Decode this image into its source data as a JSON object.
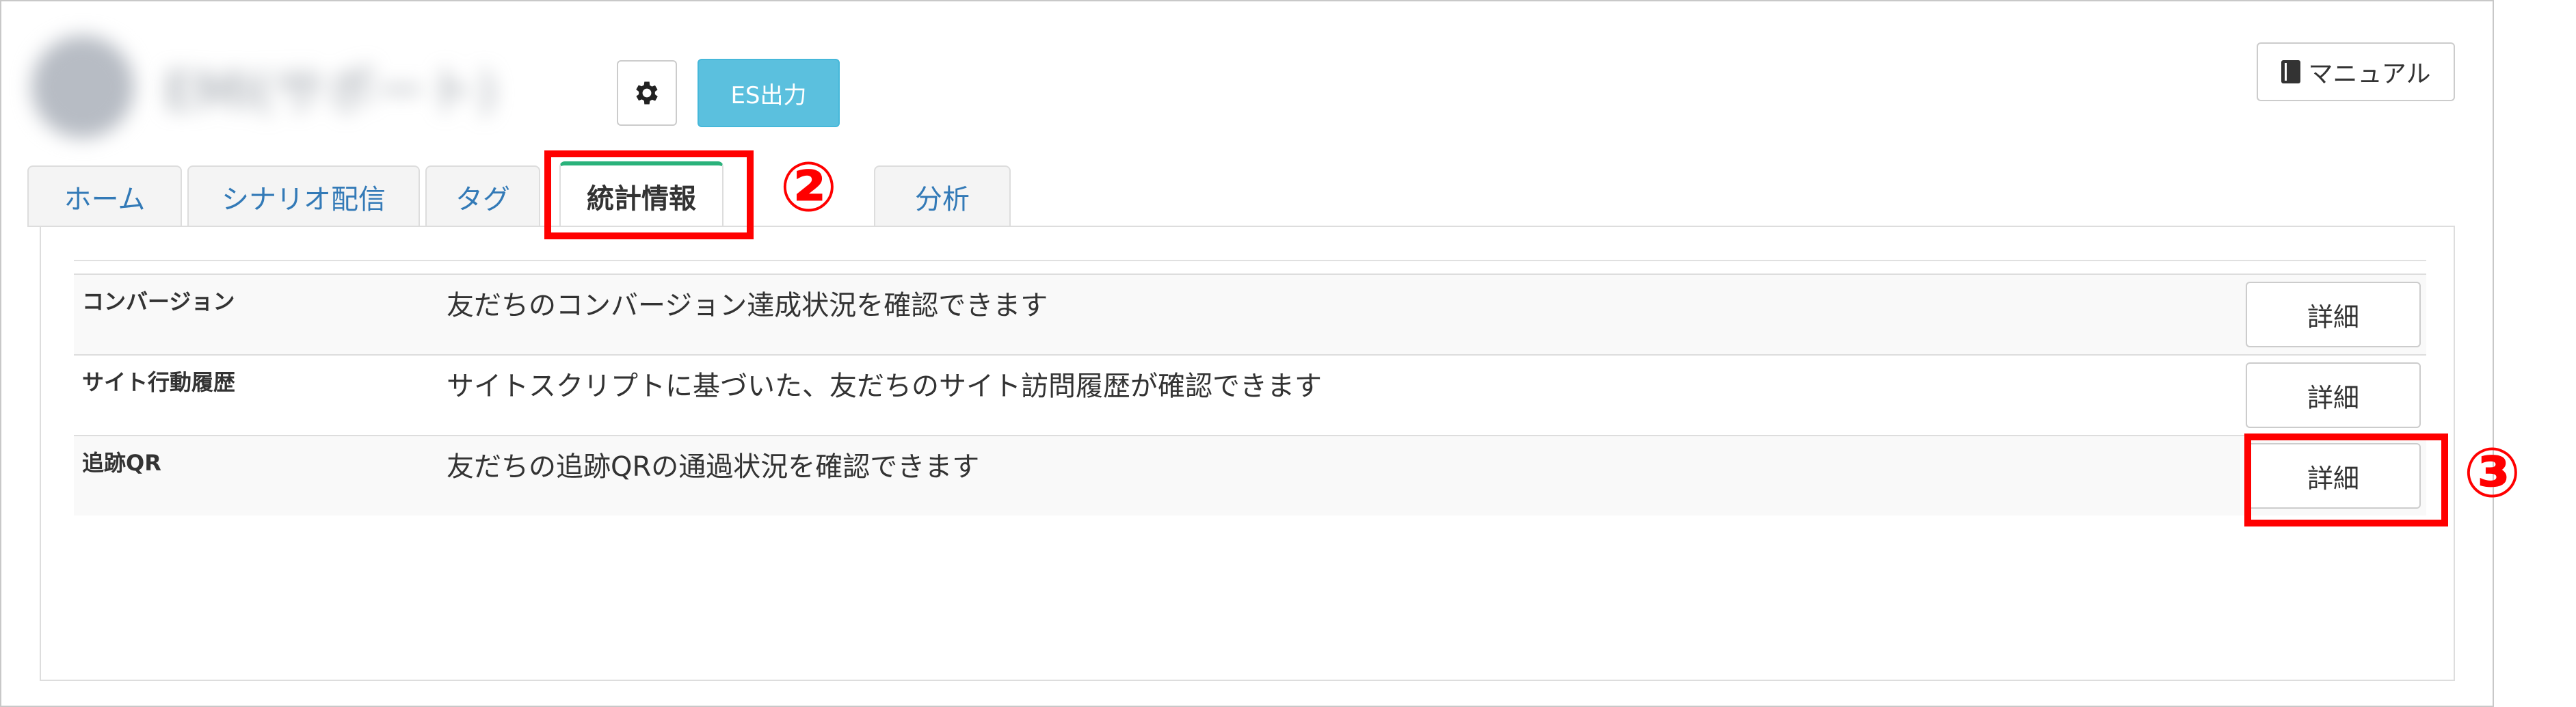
{
  "header": {
    "account_name": "EMI(サポート)",
    "es_button_label": "ES出力",
    "manual_button_label": "マニュアル"
  },
  "tabs": [
    {
      "label": "ホーム"
    },
    {
      "label": "シナリオ配信"
    },
    {
      "label": "タグ"
    },
    {
      "label": "統計情報",
      "active": true
    },
    {
      "label": "分析"
    }
  ],
  "rows": [
    {
      "name": "コンバージョン",
      "description": "友だちのコンバージョン達成状況を確認できます",
      "button_label": "詳細"
    },
    {
      "name": "サイト行動履歴",
      "description": "サイトスクリプトに基づいた、友だちのサイト訪問履歴が確認できます",
      "button_label": "詳細"
    },
    {
      "name": "追跡QR",
      "description": "友だちの追跡QRの通過状況を確認できます",
      "button_label": "詳細"
    }
  ],
  "annotations": {
    "step2": "②",
    "step3": "③"
  },
  "colors": {
    "accent": "#5bc0de",
    "active_tab_border": "#2ab27b",
    "link": "#337ab7",
    "annotation": "#ff0000"
  },
  "icons": [
    "gear-icon",
    "book-icon"
  ]
}
